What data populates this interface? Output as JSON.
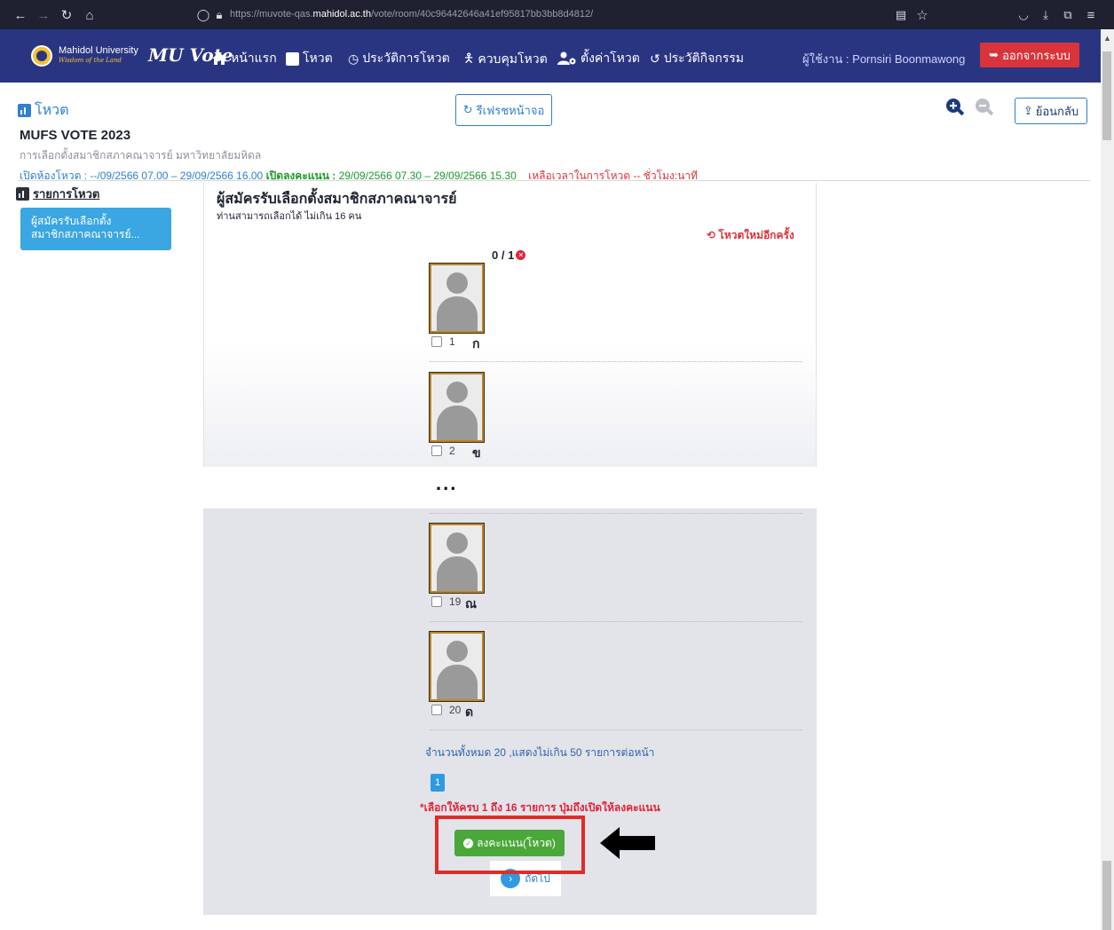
{
  "browser": {
    "url_prefix": "https://muvote-qas.",
    "url_domain": "mahidol.ac.th",
    "url_path": "/vote/room/40c96442646a41ef95817bb3bb8d4812/"
  },
  "navbar": {
    "university": "Mahidol University",
    "university_sub": "Wisdom of the Land",
    "brand": "MU Vote",
    "items": [
      {
        "label": "หน้าแรก",
        "icon": "home-icon"
      },
      {
        "label": "โหวต",
        "icon": "chart-icon"
      },
      {
        "label": "ประวัติการโหวต",
        "icon": "clock-icon"
      },
      {
        "label": "ควบคุมโหวต",
        "icon": "person-icon"
      },
      {
        "label": "ตั้งค่าโหวต",
        "icon": "user-settings-icon"
      },
      {
        "label": "ประวัติกิจกรรม",
        "icon": "history-icon"
      }
    ],
    "user_label": "ผู้ใช้งาน : Pornsiri Boonmawong",
    "logout_label": "ออกจากระบบ"
  },
  "header": {
    "section_title": "โหวต",
    "refresh_label": "รีเฟรชหน้าจอ",
    "back_label": "ย้อนกลับ",
    "event_title": "MUFS VOTE 2023",
    "event_subtitle": "การเลือกตั้งสมาชิกสภาคณาจารย์ มหาวิทยาลัยมหิดล",
    "schedule_open": "เปิดห้องโหวต : --/09/2566 07.00 – 29/09/2566 16.00",
    "schedule_vote_label": "เปิดลงคะแนน :",
    "schedule_vote_time": "29/09/2566  07.30 – 29/09/2566  15.30",
    "time_left": "เหลือเวลาในการโหวต  --  ชั่วโมง:นาที"
  },
  "sidebar": {
    "title": "รายการโหวต",
    "items": [
      {
        "line1": "ผู้สมัครรับเลือกตั้ง",
        "line2": "สมาชิกสภาคณาจารย์..."
      }
    ]
  },
  "ballot": {
    "title": "ผู้สมัครรับเลือกตั้งสมาชิกสภาคณาจารย์",
    "subtitle": "ท่านสามารถเลือกได้ ไม่เกิน 16 คน",
    "revote_label": "โหวตใหม่อีกครั้ง",
    "counter": "0 / 1",
    "candidates": [
      {
        "number": "1",
        "name": "ก"
      },
      {
        "number": "2",
        "name": "ข"
      },
      {
        "number": "19",
        "name": "ณ"
      },
      {
        "number": "20",
        "name": "ด"
      }
    ],
    "ellipsis": "...",
    "total_text": "จำนวนทั้งหมด  20 ,แสดงไม่เกิน  50 รายการต่อหน้า",
    "page": "1",
    "warning": "*เลือกให้ครบ 1 ถึง 16 รายการ ปุ่มถึงเปิดให้ลงคะแนน",
    "submit_label": "ลงคะแนน(โหวต)",
    "next_label": "ถัดไป"
  },
  "colors": {
    "navbar": "#2a3582",
    "logout": "#d9343a",
    "primary": "#2f7fd0",
    "submit": "#4aa83a",
    "highlight": "#e32a2a"
  }
}
